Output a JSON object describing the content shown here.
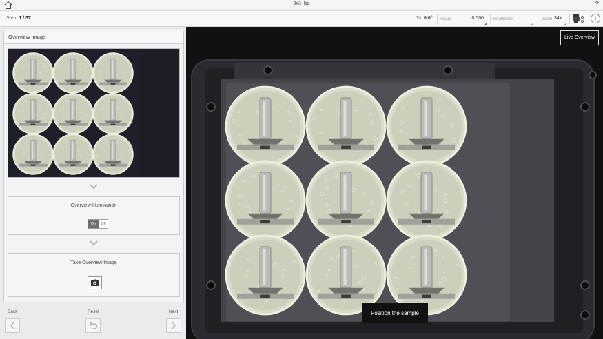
{
  "titlebar": {
    "title": "3x3_lsg",
    "help": "?"
  },
  "toolbar": {
    "step_label": "Step:",
    "step_value": "1 / 37",
    "tilt_label": "Tilt:",
    "tilt_value": "0.0°",
    "focus_label": "Focus",
    "focus_value": "0.000",
    "brightness_label": "Brightness",
    "zoom_label": "Zoom:",
    "zoom_value": "34x",
    "info": "i"
  },
  "left_panel": {
    "header": "Overview Image",
    "illumination": {
      "title": "Overview Illumination",
      "on": "On",
      "off": "Off",
      "state": "On"
    },
    "take_image": {
      "title": "Take Overview Image"
    }
  },
  "navigation": {
    "back": "Back",
    "reset": "Reset",
    "next": "Next"
  },
  "live_view": {
    "button": "Live Overview",
    "toast": "Position the sample"
  },
  "icons": [
    "home-icon",
    "camera-icon",
    "chevron-down-icon",
    "undo-icon",
    "chevron-left-icon",
    "chevron-right-icon",
    "objective-icon"
  ]
}
